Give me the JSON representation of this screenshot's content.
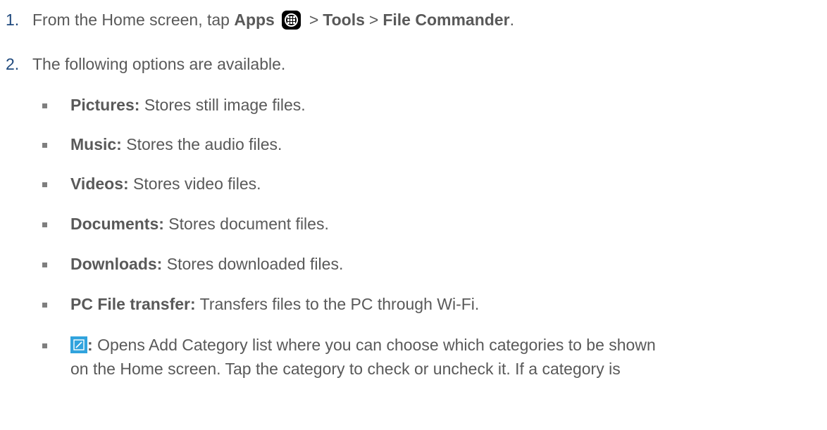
{
  "steps": [
    {
      "number": "1.",
      "prefix": "From the Home screen, tap ",
      "apps": "Apps",
      "sep1": ">",
      "tools": "Tools",
      "sep2": ">",
      "file_commander": "File Commander",
      "end": "."
    },
    {
      "number": "2.",
      "text": "The following options are available."
    }
  ],
  "options": [
    {
      "label": "Pictures:",
      "desc": "Stores still image files."
    },
    {
      "label": "Music:",
      "desc": "Stores the audio files."
    },
    {
      "label": "Videos:",
      "desc": "Stores video files."
    },
    {
      "label": "Documents:",
      "desc": "Stores document files."
    },
    {
      "label": "Downloads:",
      "desc": "Stores downloaded files."
    },
    {
      "label": "PC File transfer:",
      "desc": "Transfers files to the PC through Wi-Fi."
    }
  ],
  "edit_option": {
    "icon": "edit-icon",
    "colon": ":",
    "line1": "Opens Add Category list where you can choose which categories to be shown",
    "line2": "on the Home screen. Tap the category to check or uncheck it. If a category is"
  },
  "icons": {
    "apps": "apps-grid-icon",
    "edit": "edit-icon"
  },
  "colors": {
    "text": "#595959",
    "step_number": "#1f497d",
    "edit_icon_bg": "#31a3dd",
    "bullet": "#7f7f7f"
  }
}
